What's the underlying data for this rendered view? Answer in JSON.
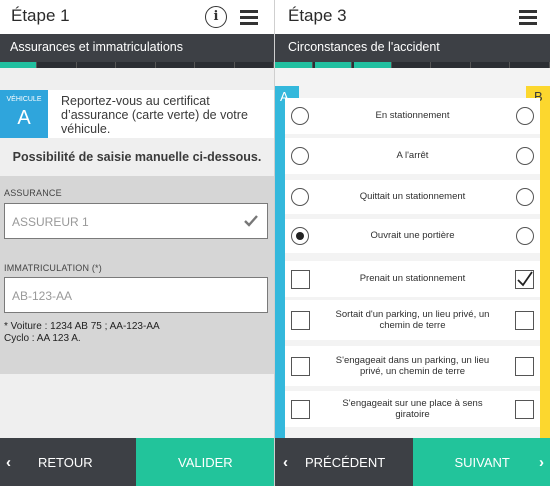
{
  "left_screen": {
    "title": "Étape 1",
    "subtitle": "Assurances et immatriculations",
    "vehicle_badge": {
      "label": "VÉHICULE",
      "letter": "A"
    },
    "vehicle_text": "Reportez-vous au certificat d’assurance (carte verte) de votre véhicule.",
    "manual_text": "Possibilité de saisie manuelle ci-dessous.",
    "insurance": {
      "label": "ASSURANCE",
      "value": "ASSUREUR 1"
    },
    "registration": {
      "label": "IMMATRICULATION (*)",
      "value": "AB-123-AA"
    },
    "notes_line1": "* Voiture : 1234 AB 75 ; AA-123-AA",
    "notes_line2": "Cyclo : AA 123 A.",
    "back_label": "RETOUR",
    "validate_label": "VALIDER",
    "progress": {
      "segments": 7,
      "active": [
        0
      ]
    }
  },
  "right_screen": {
    "title": "Étape 3",
    "subtitle": "Circonstances de l'accident",
    "column_a": "A",
    "column_b": "B",
    "progress": {
      "segments": 7,
      "active": [
        0,
        1,
        2
      ]
    },
    "circumstances": [
      {
        "label": "En stationnement",
        "control": "radio",
        "a": false,
        "b": false
      },
      {
        "label": "A l'arrêt",
        "control": "radio",
        "a": false,
        "b": false
      },
      {
        "label": "Quittait un stationnement",
        "control": "radio",
        "a": false,
        "b": false
      },
      {
        "label": "Ouvrait une portière",
        "control": "radio",
        "a": true,
        "b": false
      },
      {
        "label": "Prenait un stationnement",
        "control": "checkbox",
        "a": false,
        "b": true
      },
      {
        "label": "Sortait d'un parking, un lieu privé, un chemin de terre",
        "control": "checkbox",
        "a": false,
        "b": false
      },
      {
        "label": "S'engageait dans un parking, un lieu privé, un chemin de terre",
        "control": "checkbox",
        "a": false,
        "b": false
      },
      {
        "label": "S'engageait sur une place à sens giratoire",
        "control": "checkbox",
        "a": false,
        "b": false
      }
    ],
    "prev_label": "PRÉCÉDENT",
    "next_label": "SUIVANT"
  },
  "colors": {
    "accent_green": "#22c49b",
    "dark_bar": "#3d4045",
    "column_a_blue": "#34b8dc",
    "column_b_yellow": "#fcd72e",
    "vehicle_blue": "#2fa5dc"
  }
}
